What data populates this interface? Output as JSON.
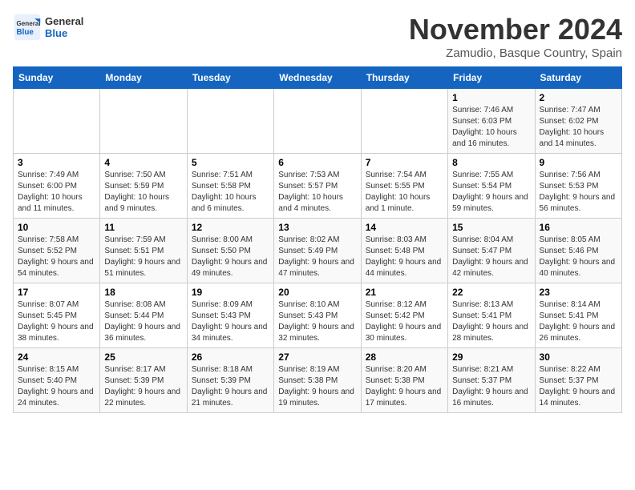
{
  "logo": {
    "line1": "General",
    "line2": "Blue"
  },
  "title": "November 2024",
  "subtitle": "Zamudio, Basque Country, Spain",
  "weekdays": [
    "Sunday",
    "Monday",
    "Tuesday",
    "Wednesday",
    "Thursday",
    "Friday",
    "Saturday"
  ],
  "weeks": [
    [
      {
        "day": "",
        "info": ""
      },
      {
        "day": "",
        "info": ""
      },
      {
        "day": "",
        "info": ""
      },
      {
        "day": "",
        "info": ""
      },
      {
        "day": "",
        "info": ""
      },
      {
        "day": "1",
        "info": "Sunrise: 7:46 AM\nSunset: 6:03 PM\nDaylight: 10 hours and 16 minutes."
      },
      {
        "day": "2",
        "info": "Sunrise: 7:47 AM\nSunset: 6:02 PM\nDaylight: 10 hours and 14 minutes."
      }
    ],
    [
      {
        "day": "3",
        "info": "Sunrise: 7:49 AM\nSunset: 6:00 PM\nDaylight: 10 hours and 11 minutes."
      },
      {
        "day": "4",
        "info": "Sunrise: 7:50 AM\nSunset: 5:59 PM\nDaylight: 10 hours and 9 minutes."
      },
      {
        "day": "5",
        "info": "Sunrise: 7:51 AM\nSunset: 5:58 PM\nDaylight: 10 hours and 6 minutes."
      },
      {
        "day": "6",
        "info": "Sunrise: 7:53 AM\nSunset: 5:57 PM\nDaylight: 10 hours and 4 minutes."
      },
      {
        "day": "7",
        "info": "Sunrise: 7:54 AM\nSunset: 5:55 PM\nDaylight: 10 hours and 1 minute."
      },
      {
        "day": "8",
        "info": "Sunrise: 7:55 AM\nSunset: 5:54 PM\nDaylight: 9 hours and 59 minutes."
      },
      {
        "day": "9",
        "info": "Sunrise: 7:56 AM\nSunset: 5:53 PM\nDaylight: 9 hours and 56 minutes."
      }
    ],
    [
      {
        "day": "10",
        "info": "Sunrise: 7:58 AM\nSunset: 5:52 PM\nDaylight: 9 hours and 54 minutes."
      },
      {
        "day": "11",
        "info": "Sunrise: 7:59 AM\nSunset: 5:51 PM\nDaylight: 9 hours and 51 minutes."
      },
      {
        "day": "12",
        "info": "Sunrise: 8:00 AM\nSunset: 5:50 PM\nDaylight: 9 hours and 49 minutes."
      },
      {
        "day": "13",
        "info": "Sunrise: 8:02 AM\nSunset: 5:49 PM\nDaylight: 9 hours and 47 minutes."
      },
      {
        "day": "14",
        "info": "Sunrise: 8:03 AM\nSunset: 5:48 PM\nDaylight: 9 hours and 44 minutes."
      },
      {
        "day": "15",
        "info": "Sunrise: 8:04 AM\nSunset: 5:47 PM\nDaylight: 9 hours and 42 minutes."
      },
      {
        "day": "16",
        "info": "Sunrise: 8:05 AM\nSunset: 5:46 PM\nDaylight: 9 hours and 40 minutes."
      }
    ],
    [
      {
        "day": "17",
        "info": "Sunrise: 8:07 AM\nSunset: 5:45 PM\nDaylight: 9 hours and 38 minutes."
      },
      {
        "day": "18",
        "info": "Sunrise: 8:08 AM\nSunset: 5:44 PM\nDaylight: 9 hours and 36 minutes."
      },
      {
        "day": "19",
        "info": "Sunrise: 8:09 AM\nSunset: 5:43 PM\nDaylight: 9 hours and 34 minutes."
      },
      {
        "day": "20",
        "info": "Sunrise: 8:10 AM\nSunset: 5:43 PM\nDaylight: 9 hours and 32 minutes."
      },
      {
        "day": "21",
        "info": "Sunrise: 8:12 AM\nSunset: 5:42 PM\nDaylight: 9 hours and 30 minutes."
      },
      {
        "day": "22",
        "info": "Sunrise: 8:13 AM\nSunset: 5:41 PM\nDaylight: 9 hours and 28 minutes."
      },
      {
        "day": "23",
        "info": "Sunrise: 8:14 AM\nSunset: 5:41 PM\nDaylight: 9 hours and 26 minutes."
      }
    ],
    [
      {
        "day": "24",
        "info": "Sunrise: 8:15 AM\nSunset: 5:40 PM\nDaylight: 9 hours and 24 minutes."
      },
      {
        "day": "25",
        "info": "Sunrise: 8:17 AM\nSunset: 5:39 PM\nDaylight: 9 hours and 22 minutes."
      },
      {
        "day": "26",
        "info": "Sunrise: 8:18 AM\nSunset: 5:39 PM\nDaylight: 9 hours and 21 minutes."
      },
      {
        "day": "27",
        "info": "Sunrise: 8:19 AM\nSunset: 5:38 PM\nDaylight: 9 hours and 19 minutes."
      },
      {
        "day": "28",
        "info": "Sunrise: 8:20 AM\nSunset: 5:38 PM\nDaylight: 9 hours and 17 minutes."
      },
      {
        "day": "29",
        "info": "Sunrise: 8:21 AM\nSunset: 5:37 PM\nDaylight: 9 hours and 16 minutes."
      },
      {
        "day": "30",
        "info": "Sunrise: 8:22 AM\nSunset: 5:37 PM\nDaylight: 9 hours and 14 minutes."
      }
    ]
  ]
}
